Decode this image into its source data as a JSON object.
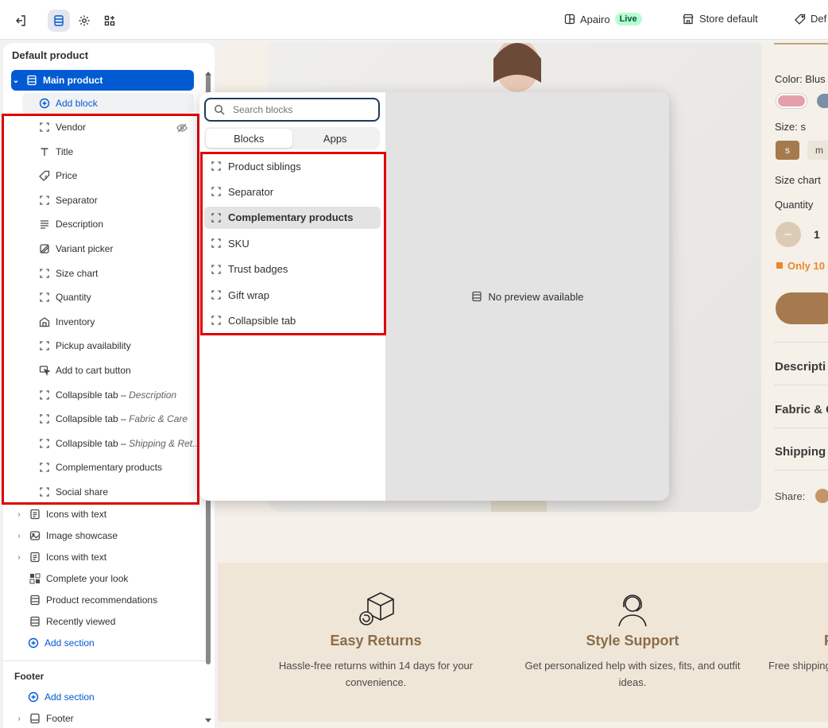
{
  "topbar": {
    "store_name": "Apairo",
    "live_badge": "Live",
    "store_default": "Store default",
    "default_cut": "Def"
  },
  "sidebar": {
    "title": "Default product",
    "main_product": "Main product",
    "add_block": "Add block",
    "blocks": [
      {
        "label": "Vendor",
        "icon": "block-icon"
      },
      {
        "label": "Title",
        "icon": "title-icon"
      },
      {
        "label": "Price",
        "icon": "price-icon"
      },
      {
        "label": "Separator",
        "icon": "block-icon"
      },
      {
        "label": "Description",
        "icon": "text-icon"
      },
      {
        "label": "Variant picker",
        "icon": "variant-icon"
      },
      {
        "label": "Size chart",
        "icon": "block-icon"
      },
      {
        "label": "Quantity",
        "icon": "block-icon"
      },
      {
        "label": "Inventory",
        "icon": "inventory-icon"
      },
      {
        "label": "Pickup availability",
        "icon": "block-icon"
      },
      {
        "label": "Add to cart button",
        "icon": "cursor-icon"
      },
      {
        "label": "Collapsible tab",
        "suffix": "Description",
        "icon": "block-icon"
      },
      {
        "label": "Collapsible tab",
        "suffix": "Fabric & Care",
        "icon": "block-icon"
      },
      {
        "label": "Collapsible tab",
        "suffix": "Shipping & Ret...",
        "icon": "block-icon"
      },
      {
        "label": "Complementary products",
        "icon": "block-icon"
      },
      {
        "label": "Social share",
        "icon": "block-icon"
      }
    ],
    "block_separator": " – ",
    "sections": [
      {
        "label": "Icons with text",
        "expandable": true
      },
      {
        "label": "Image showcase",
        "expandable": true
      },
      {
        "label": "Icons with text",
        "expandable": true
      },
      {
        "label": "Complete your look",
        "expandable": false
      },
      {
        "label": "Product recommendations",
        "expandable": false
      },
      {
        "label": "Recently viewed",
        "expandable": false
      }
    ],
    "add_section": "Add section",
    "footer_title": "Footer",
    "footer_add_section": "Add section",
    "footer_item": "Footer"
  },
  "popover": {
    "search_placeholder": "Search blocks",
    "tabs": [
      "Blocks",
      "Apps"
    ],
    "selected_tab": "Blocks",
    "items": [
      "Product siblings",
      "Separator",
      "Complementary products",
      "SKU",
      "Trust badges",
      "Gift wrap",
      "Collapsible tab"
    ],
    "highlighted_item": "Complementary products",
    "no_preview": "No preview available"
  },
  "preview": {
    "color_label": "Color: Blus",
    "size_label": "Size: s",
    "size_options": [
      "s",
      "m"
    ],
    "size_chart": "Size chart",
    "quantity_label": "Quantity",
    "quantity_value": "1",
    "stock_note": "Only 10",
    "accordions": [
      "Descripti",
      "Fabric & C",
      "Shipping"
    ],
    "share_label": "Share:",
    "features": [
      {
        "title": "Easy Returns",
        "text": "Hassle-free returns within 14 days for your convenience."
      },
      {
        "title": "Style Support",
        "text": "Get personalized help with sizes, fits, and outfit ideas."
      },
      {
        "title": "F",
        "text": "Free shipping"
      }
    ],
    "colors": {
      "accent": "#a57a4e",
      "swatch_pink": "#e4a0aa",
      "swatch_blue": "#7a8ea6",
      "stock": "#e8892a"
    }
  }
}
